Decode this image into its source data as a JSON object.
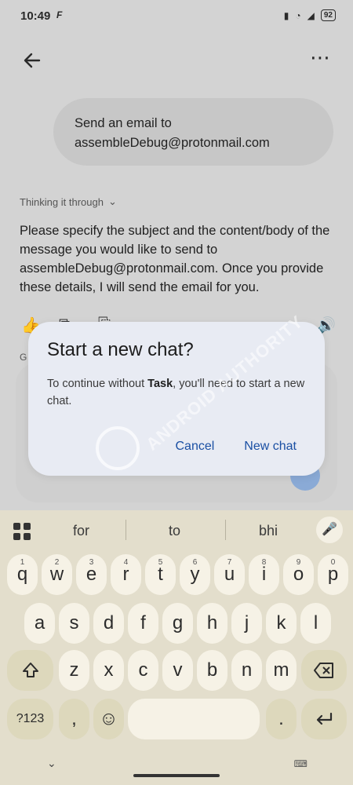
{
  "status": {
    "time": "10:49",
    "app_glyph": "F",
    "battery": "92"
  },
  "chat": {
    "user_message": "Send an email to assembleDebug@protonmail.com",
    "thinking_label": "Thinking it through",
    "answer": "Please specify the subject and the content/body of the message you would like to send to assembleDebug@protonmail.com. Once you provide these details, I will send the email for you.",
    "input_label_partial": "G"
  },
  "dialog": {
    "title": "Start a new chat?",
    "message_prefix": "To continue without ",
    "message_bold": "Task",
    "message_suffix": ", you'll need to start a new chat.",
    "cancel": "Cancel",
    "confirm": "New chat"
  },
  "watermark": {
    "text": "ANDROID AUTHORITY"
  },
  "keyboard": {
    "suggestions": [
      "for",
      "to",
      "bhi"
    ],
    "row1": [
      [
        "q",
        "1"
      ],
      [
        "w",
        "2"
      ],
      [
        "e",
        "3"
      ],
      [
        "r",
        "4"
      ],
      [
        "t",
        "5"
      ],
      [
        "y",
        "6"
      ],
      [
        "u",
        "7"
      ],
      [
        "i",
        "8"
      ],
      [
        "o",
        "9"
      ],
      [
        "p",
        "0"
      ]
    ],
    "row2": [
      "a",
      "s",
      "d",
      "f",
      "g",
      "h",
      "j",
      "k",
      "l"
    ],
    "row3": [
      "z",
      "x",
      "c",
      "v",
      "b",
      "n",
      "m"
    ],
    "symbols_key": "?123",
    "comma": ",",
    "period": "."
  },
  "colors": {
    "accent": "#1a4fa3",
    "dialog_bg": "#e8ebf3",
    "keyboard_bg": "#e3decc"
  }
}
